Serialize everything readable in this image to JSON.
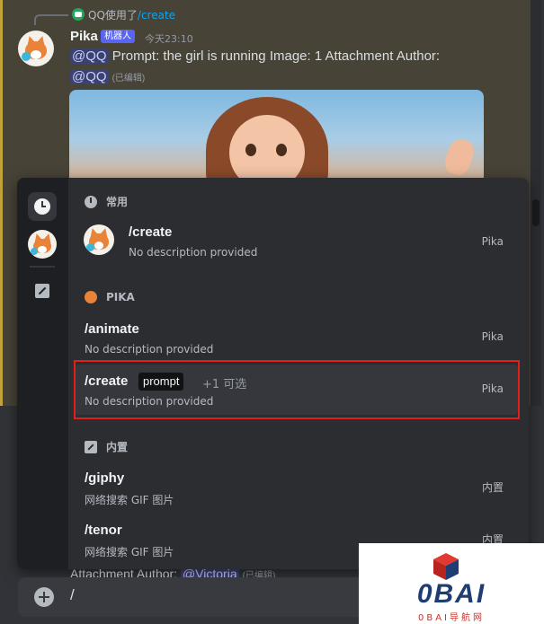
{
  "reply": {
    "prefix": "QQ使用了",
    "command": "/create"
  },
  "message": {
    "author": "Pika",
    "bot_badge": "机器人",
    "timestamp": "今天23:10",
    "mention": "@QQ",
    "text": "Prompt: the girl is running  Image: 1 Attachment  Author:",
    "mention2": "@QQ",
    "edited": "(已编辑)"
  },
  "behind_text": {
    "text": "Attachment  Author: ",
    "mention": "@Victoria",
    "edited": "(已编辑)"
  },
  "popup": {
    "sections": [
      {
        "title": "常用",
        "commands": [
          {
            "name": "/create",
            "desc": "No description provided",
            "source": "Pika"
          }
        ]
      },
      {
        "title": "PIKA",
        "commands": [
          {
            "name": "/animate",
            "desc": "No description provided",
            "source": "Pika"
          },
          {
            "name": "/create",
            "option": "prompt",
            "more": "+1 可选",
            "desc": "No description provided",
            "source": "Pika"
          }
        ]
      },
      {
        "title": "内置",
        "commands": [
          {
            "name": "/giphy",
            "desc": "网络搜索 GIF 图片",
            "source": "内置"
          },
          {
            "name": "/tenor",
            "desc": "网络搜索 GIF 图片",
            "source": "内置"
          }
        ]
      }
    ]
  },
  "composer": {
    "value": "/"
  },
  "watermark": {
    "logo": "0BAI",
    "sub": "0BAI导航网"
  },
  "colors": {
    "highlight": "#484337",
    "selection_border": "#e0201a",
    "bot_badge": "#5865f2",
    "popup_bg": "#2b2d31"
  }
}
